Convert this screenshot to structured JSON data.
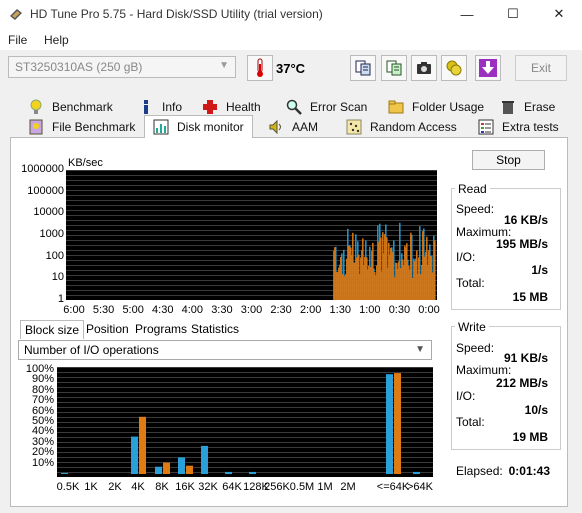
{
  "window": {
    "title": "HD Tune Pro 5.75 - Hard Disk/SSD Utility (trial version)",
    "min_symbol": "—",
    "max_symbol": "☐",
    "close_symbol": "✕"
  },
  "menu": {
    "file": "File",
    "help": "Help"
  },
  "toolbar": {
    "drive": "ST3250310AS (250 gB)",
    "temperature": "37°C",
    "exit_label": "Exit"
  },
  "tabs_row1": [
    {
      "label": "Benchmark",
      "icon": "lightbulb-icon"
    },
    {
      "label": "Info",
      "icon": "info-icon"
    },
    {
      "label": "Health",
      "icon": "health-cross-icon"
    },
    {
      "label": "Error Scan",
      "icon": "magnifier-icon"
    },
    {
      "label": "Folder Usage",
      "icon": "folder-icon"
    },
    {
      "label": "Erase",
      "icon": "trash-icon"
    }
  ],
  "tabs_row2": [
    {
      "label": "File Benchmark",
      "icon": "file-bulb-icon"
    },
    {
      "label": "Disk monitor",
      "icon": "chart-icon"
    },
    {
      "label": "AAM",
      "icon": "speaker-icon"
    },
    {
      "label": "Random Access",
      "icon": "grid-icon"
    },
    {
      "label": "Extra tests",
      "icon": "list-icon"
    }
  ],
  "monitor": {
    "unit_label": "KB/sec",
    "y_ticks": [
      "1000000",
      "100000",
      "10000",
      "1000",
      "100",
      "10",
      "1"
    ],
    "x_ticks": [
      "6:00",
      "5:30",
      "5:00",
      "4:30",
      "4:00",
      "3:30",
      "3:00",
      "2:30",
      "2:00",
      "1:30",
      "1:00",
      "0:30",
      "0:00"
    ],
    "stop_label": "Stop"
  },
  "subtabs": [
    "Block size",
    "Position",
    "Programs",
    "Statistics"
  ],
  "combo_value": "Number of I/O operations",
  "blocksize_chart": {
    "y_ticks": [
      "100%",
      "90%",
      "80%",
      "70%",
      "60%",
      "50%",
      "40%",
      "30%",
      "20%",
      "10%"
    ],
    "x_ticks": [
      "0.5K",
      "1K",
      "2K",
      "4K",
      "8K",
      "16K",
      "32K",
      "64K",
      "128K",
      "256K",
      "0.5M",
      "1M",
      "2M",
      "<=64K",
      ">64K"
    ]
  },
  "read": {
    "title": "Read",
    "speed_label": "Speed:",
    "speed": "16 KB/s",
    "max_label": "Maximum:",
    "max": "195 MB/s",
    "io_label": "I/O:",
    "io": "1/s",
    "total_label": "Total:",
    "total": "15 MB"
  },
  "write": {
    "title": "Write",
    "speed_label": "Speed:",
    "speed": "91 KB/s",
    "max_label": "Maximum:",
    "max": "212 MB/s",
    "io_label": "I/O:",
    "io": "10/s",
    "total_label": "Total:",
    "total": "19 MB"
  },
  "elapsed": {
    "label": "Elapsed:",
    "value": "0:01:43"
  },
  "chart_data": [
    {
      "type": "line",
      "ylabel": "KB/sec",
      "yscale": "log",
      "ylim": [
        1,
        1000000
      ],
      "x_ticks": [
        "6:00",
        "5:30",
        "5:00",
        "4:30",
        "4:00",
        "3:30",
        "3:00",
        "2:30",
        "2:00",
        "1:30",
        "1:00",
        "0:30",
        "0:00"
      ],
      "series": [
        {
          "color": "#2a9fd8"
        },
        {
          "color": "#e07b14"
        }
      ]
    },
    {
      "type": "bar",
      "categories": [
        "0.5K",
        "1K",
        "2K",
        "4K",
        "8K",
        "16K",
        "32K",
        "64K",
        "128K",
        "256K",
        "0.5M",
        "1M",
        "2M",
        "<=64K",
        ">64K"
      ],
      "ylim": [
        0,
        100
      ],
      "series": [
        {
          "color": "#2a9fd8",
          "values": [
            1,
            0,
            0,
            36,
            7,
            16,
            27,
            2,
            2,
            0,
            0,
            0,
            0,
            96,
            2
          ]
        },
        {
          "color": "#e07b14",
          "values": [
            0,
            0,
            0,
            55,
            11,
            8,
            0,
            0,
            0,
            0,
            0,
            0,
            0,
            97,
            0
          ]
        }
      ]
    }
  ]
}
